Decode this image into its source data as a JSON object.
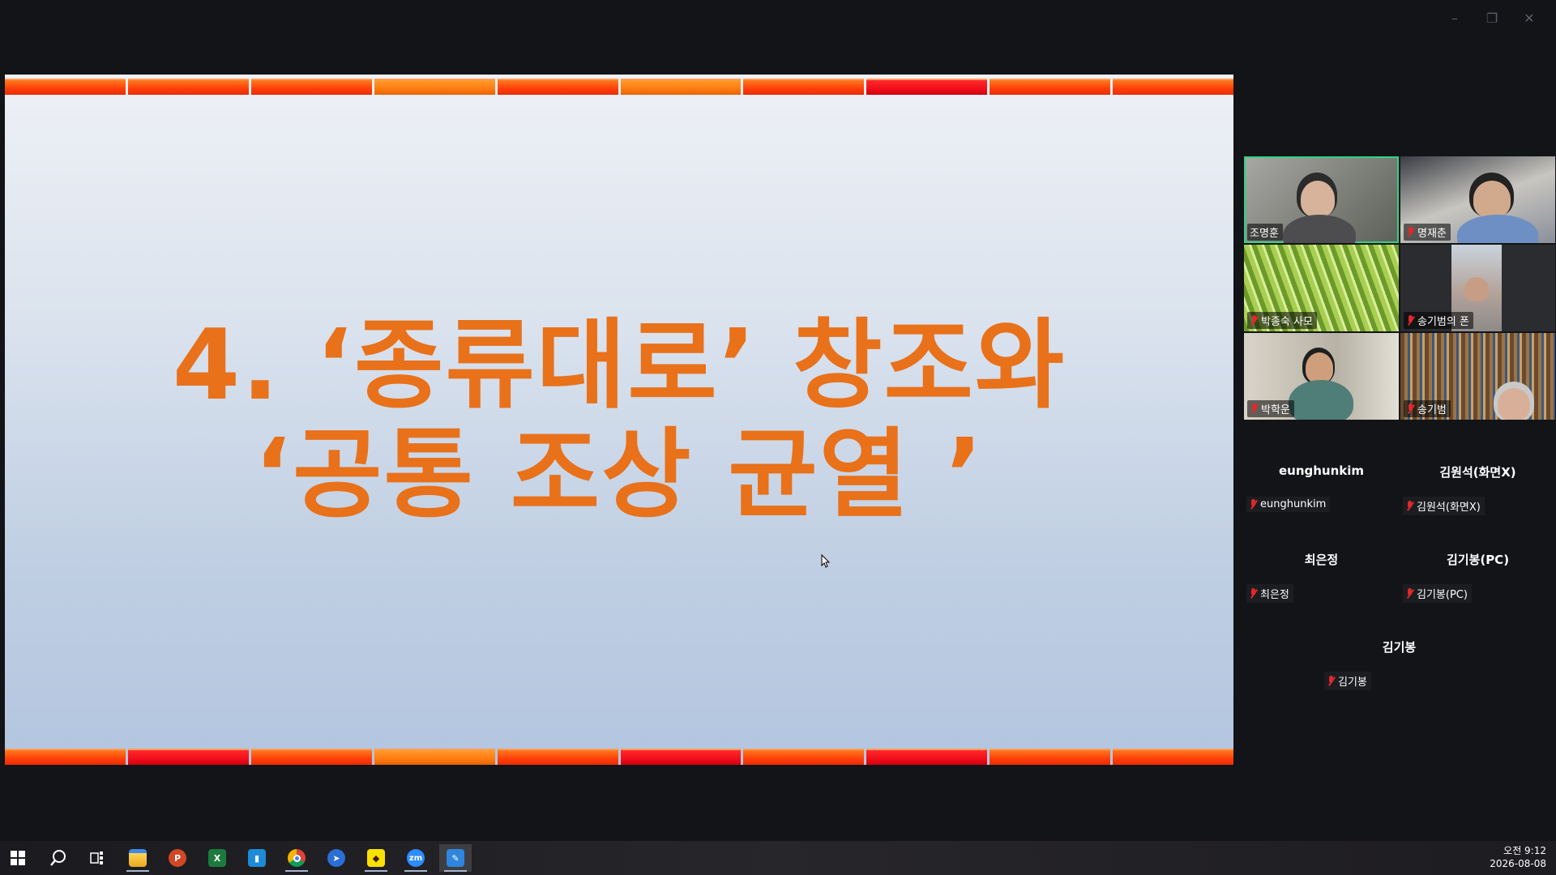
{
  "window": {
    "controls": {
      "minimize_icon": "minimize-icon",
      "restore_icon": "restore-icon",
      "close_icon": "close-icon"
    }
  },
  "slide": {
    "line1": "4.  ‘종류대로’  창조와",
    "line2": "‘공통 조상 균열 ’",
    "title_color": "#e8711a"
  },
  "participants": {
    "video": [
      {
        "name": "조명훈",
        "muted": false,
        "active_speaker": true
      },
      {
        "name": "명재춘",
        "muted": true
      },
      {
        "name": "박종숙 사모",
        "muted": true
      },
      {
        "name": "송기범의 폰",
        "muted": true
      },
      {
        "name": "박학운",
        "muted": true
      },
      {
        "name": "송기범",
        "muted": true
      }
    ],
    "audio": [
      {
        "display": "eunghunkim",
        "label": "eunghunkim"
      },
      {
        "display": "김원석(화면X)",
        "label": "김원석(화면X)"
      },
      {
        "display": "최은정",
        "label": "최은정"
      },
      {
        "display": "김기봉(PC)",
        "label": "김기봉(PC)"
      },
      {
        "display": "김기봉",
        "label": "김기봉"
      }
    ]
  },
  "taskbar": {
    "apps": [
      "start",
      "search",
      "task-view",
      "file-explorer",
      "powerpoint",
      "excel",
      "app-blue",
      "chrome",
      "app-arrow",
      "kakaotalk",
      "zoom",
      "whiteboard"
    ],
    "clock": {
      "time": "오전 9:12",
      "date": "2026-08-08"
    }
  }
}
